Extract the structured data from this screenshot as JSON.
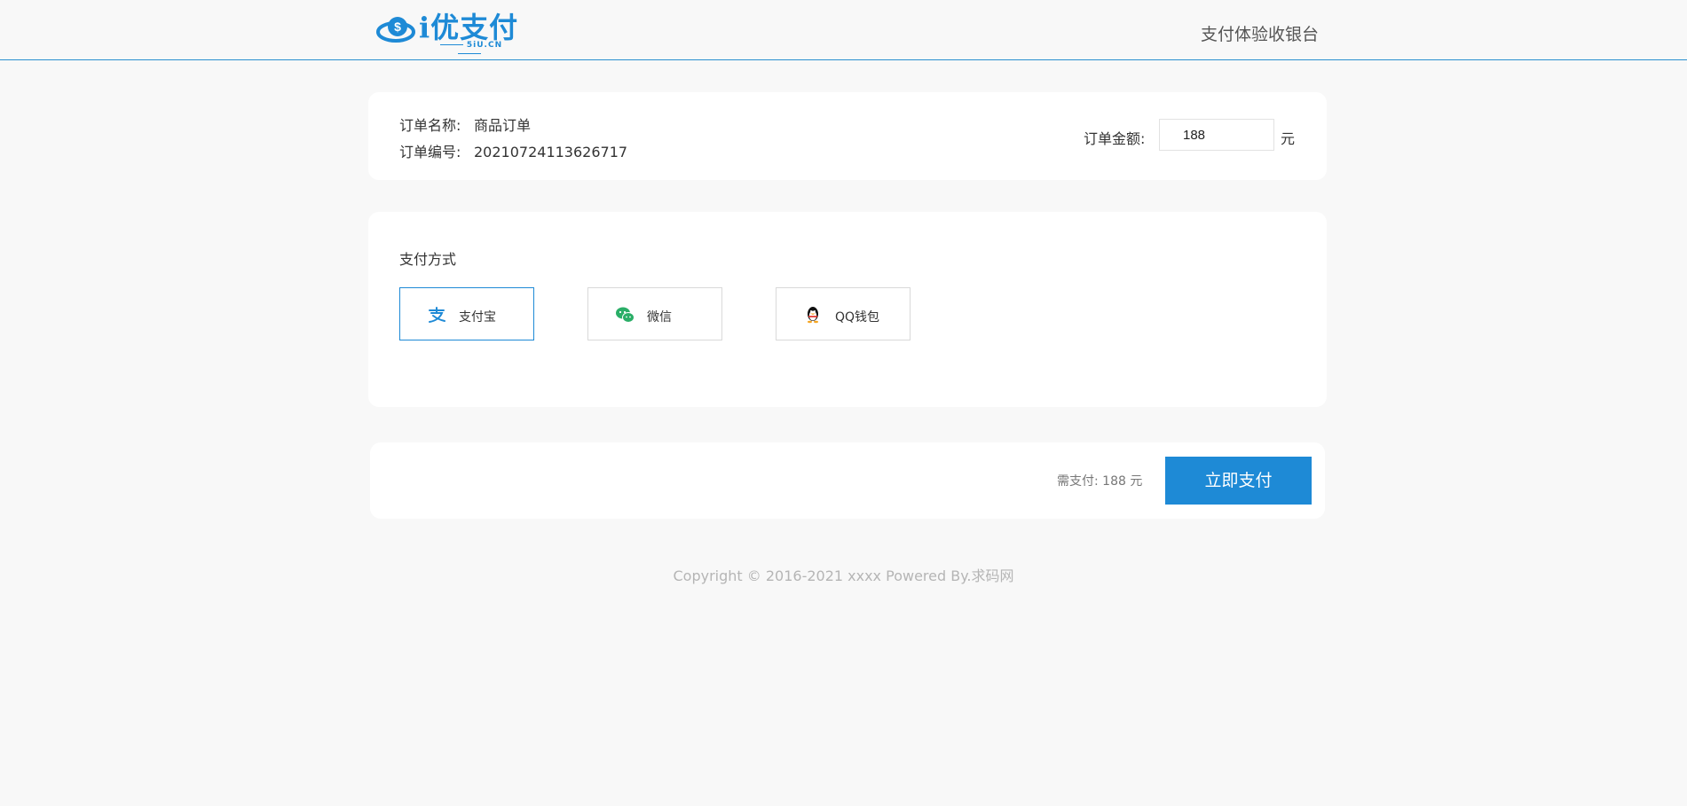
{
  "header": {
    "logo_brand": "i优支付",
    "logo_domain": "5iU.CN",
    "title": "支付体验收银台"
  },
  "order": {
    "name_label": "订单名称:",
    "name_value": "商品订单",
    "number_label": "订单编号:",
    "number_value": "20210724113626717",
    "amount_label": "订单金额:",
    "amount_value": "188",
    "amount_unit": "元"
  },
  "payment": {
    "title": "支付方式",
    "methods": [
      {
        "label": "支付宝",
        "icon": "alipay-icon",
        "selected": true
      },
      {
        "label": "微信",
        "icon": "wechat-icon",
        "selected": false
      },
      {
        "label": "QQ钱包",
        "icon": "qq-wallet-icon",
        "selected": false
      }
    ]
  },
  "checkout": {
    "need_pay_text": "需支付: 188 元",
    "pay_button_label": "立即支付"
  },
  "footer": {
    "copyright": "Copyright © 2016-2021 xxxx Powered By.求码网"
  },
  "colors": {
    "accent": "#1e8ad6",
    "background": "#f8f8f8",
    "wechat_green": "#2aae67"
  }
}
